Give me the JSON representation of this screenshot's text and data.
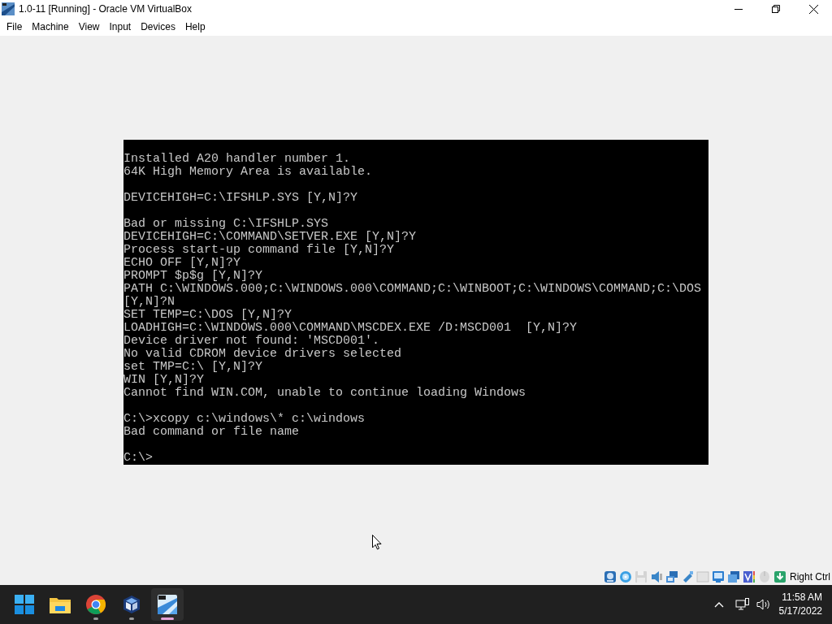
{
  "window": {
    "title": "1.0-11 [Running] - Oracle VM VirtualBox"
  },
  "menu": [
    "File",
    "Machine",
    "View",
    "Input",
    "Devices",
    "Help"
  ],
  "console": {
    "blocks": [
      [
        "Installed A20 handler number 1.",
        "64K High Memory Area is available."
      ],
      [
        "DEVICEHIGH=C:\\IFSHLP.SYS [Y,N]?Y"
      ],
      [
        "Bad or missing C:\\IFSHLP.SYS",
        "DEVICEHIGH=C:\\COMMAND\\SETVER.EXE [Y,N]?Y",
        "Process start-up command file [Y,N]?Y",
        "ECHO OFF [Y,N]?Y",
        "PROMPT $p$g [Y,N]?Y",
        "PATH C:\\WINDOWS.000;C:\\WINDOWS.000\\COMMAND;C:\\WINBOOT;C:\\WINDOWS\\COMMAND;C:\\DOS",
        "[Y,N]?N",
        "SET TEMP=C:\\DOS [Y,N]?Y",
        "LOADHIGH=C:\\WINDOWS.000\\COMMAND\\MSCDEX.EXE /D:MSCD001  [Y,N]?Y",
        "Device driver not found: 'MSCD001'.",
        "No valid CDROM device drivers selected",
        "set TMP=C:\\ [Y,N]?Y",
        "WIN [Y,N]?Y",
        "Cannot find WIN.COM, unable to continue loading Windows"
      ],
      [
        "C:\\>xcopy c:\\windows\\* c:\\windows",
        "Bad command or file name"
      ],
      [
        "C:\\>"
      ]
    ]
  },
  "status_bar": {
    "host_key": "Right Ctrl"
  },
  "taskbar": {
    "apps": [
      {
        "kind": "start",
        "running": false,
        "selected": false
      },
      {
        "kind": "explorer",
        "running": false,
        "selected": false
      },
      {
        "kind": "chrome",
        "running": true,
        "selected": false
      },
      {
        "kind": "virtualbox",
        "running": true,
        "selected": false
      },
      {
        "kind": "vm",
        "running": true,
        "selected": true
      }
    ],
    "time": "11:58 AM",
    "date": "5/17/2022"
  }
}
